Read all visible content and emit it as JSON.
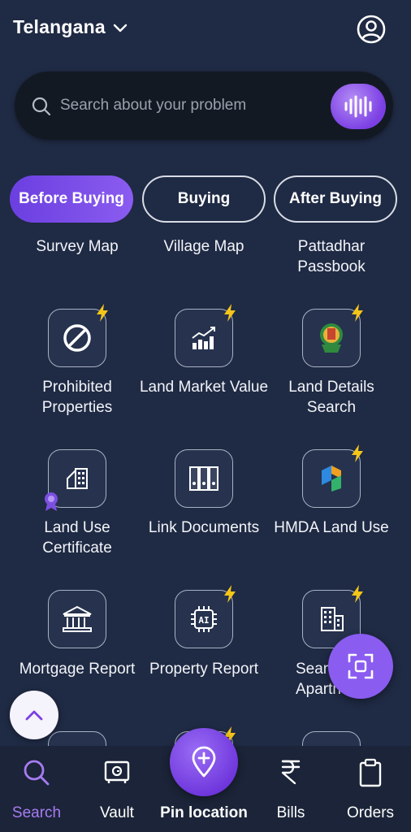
{
  "header": {
    "state": "Telangana",
    "state_icon": "chevron-down-icon",
    "profile_icon": "user-circle-icon"
  },
  "search": {
    "placeholder": "Search about your problem",
    "voice_icon": "voice-wave-icon"
  },
  "tabs": [
    {
      "label": "Before Buying",
      "active": true
    },
    {
      "label": "Buying",
      "active": false
    },
    {
      "label": "After Buying",
      "active": false
    }
  ],
  "services": {
    "row0": [
      "Survey Map",
      "Village Map",
      "Pattadhar Passbook"
    ],
    "items": [
      {
        "label": "Prohibited Properties",
        "icon": "prohibited-icon",
        "premium": true
      },
      {
        "label": "Land Market Value",
        "icon": "bar-chart-icon",
        "premium": true
      },
      {
        "label": "Land Details Search",
        "icon": "state-emblem-icon",
        "premium": true
      },
      {
        "label": "Land Use Certificate",
        "icon": "building-certificate-icon",
        "premium": false
      },
      {
        "label": "Link Documents",
        "icon": "binders-icon",
        "premium": false
      },
      {
        "label": "HMDA Land Use",
        "icon": "hmda-logo-icon",
        "premium": true
      },
      {
        "label": "Mortgage Report",
        "icon": "bank-icon",
        "premium": false
      },
      {
        "label": "Property Report",
        "icon": "ai-chip-icon",
        "premium": true
      },
      {
        "label": "Search Apartments",
        "visible_text": "Sear\nApartn",
        "icon": "apartment-icon",
        "premium": true
      }
    ]
  },
  "fab": {
    "icon": "scan-icon"
  },
  "scroll_top": {
    "icon": "chevron-up-icon"
  },
  "bottom_nav": [
    {
      "label": "Search",
      "icon": "search-icon",
      "active": true
    },
    {
      "label": "Vault",
      "icon": "vault-icon",
      "active": false
    },
    {
      "label": "Pin location",
      "icon": "location-pin-plus-icon",
      "active": false
    },
    {
      "label": "Bills",
      "icon": "rupee-icon",
      "active": false
    },
    {
      "label": "Orders",
      "icon": "clipboard-icon",
      "active": false
    }
  ],
  "colors": {
    "background": "#1f2a44",
    "accent": "#8b5cf0",
    "search_bg": "#131922",
    "bolt": "#f5c518",
    "nav_bg": "#1b2438"
  }
}
